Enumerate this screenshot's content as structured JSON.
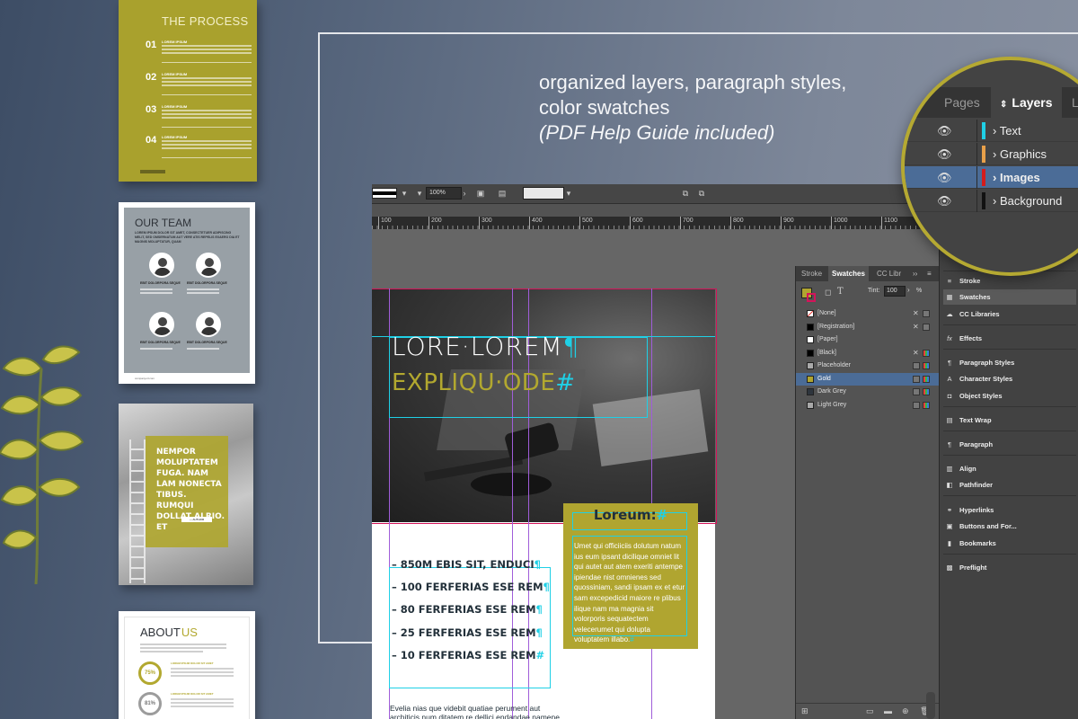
{
  "headline": {
    "line1": "organized layers, paragraph styles,",
    "line2": "color swatches",
    "line3": "(PDF Help Guide included)"
  },
  "thumbnails": {
    "process": {
      "title": "THE PROCESS",
      "steps": [
        {
          "num": "01",
          "title": "LOREM IPSUM"
        },
        {
          "num": "02",
          "title": "LOREM IPSUM"
        },
        {
          "num": "03",
          "title": "LOREM IPSUM"
        },
        {
          "num": "04",
          "title": "LOREM IPSUM"
        }
      ]
    },
    "team": {
      "title": "OUR TEAM",
      "intro": "LOREM IPSUM DOLOR SIT AMET, CONSECTETUER ADIPISCING MELIT, SED OMSERNATUM AUT VERE ATIS REPELIS EXAERO DIA ET MAGNIS MOLUPTATUR, QUAM",
      "members": [
        "EBIT DOLORPORA SEQUE",
        "EBIT DOLORPORA SEQUE",
        "EBIT DOLORPORA SEQUE",
        "EBIT DOLORPORA SEQUE"
      ],
      "footer": "companyurl.com"
    },
    "quote": {
      "text": "NEMPOR MOLUPTATEM FUGA. NAM LAM NONECTA TIBUS. RUMQUI DOLLAT ALRIO. ET",
      "button": "— AUTHOR"
    },
    "about": {
      "title_a": "ABOUT",
      "title_b": "US",
      "stat1": "75%",
      "stat2": "81%",
      "stat_label": "LOREM IPSUM DOLOR SIT AMET"
    }
  },
  "indesign": {
    "zoom": "100%",
    "ruler_ticks": [
      "100",
      "200",
      "300",
      "400",
      "500",
      "600",
      "700",
      "800",
      "900",
      "1000",
      "1100"
    ],
    "page": {
      "title1": "LORE·LOREM",
      "title1_mark": "¶",
      "title2": "EXPLIQU·ODE",
      "title2_mark": "#",
      "box_title": "Loreum:",
      "box_title_mark": "#",
      "box_body": "Umet qui officiiciis dolutum natum ius eum ipsant dicilique omniet lit qui autet aut atem exeriti antempe ipiendae nist omnienes sed quossiniam, sandi ipsam ex et etur sam excepedicid maiore re plibus ilique nam ma magnia sit volorporis sequatectem velecerumet qui dolupta voluptatem illabo.",
      "box_body_mark": "#",
      "list": [
        {
          "text": "– 850M EBIS SIT, ENDUCI",
          "mark": "¶"
        },
        {
          "text": "– 100 FERFERIAS ESE REM",
          "mark": "¶"
        },
        {
          "text": "– 80 FERFERIAS ESE REM",
          "mark": "¶"
        },
        {
          "text": "– 25 FERFERIAS ESE REM",
          "mark": "¶"
        },
        {
          "text": "– 10 FERFERIAS ESE REM",
          "mark": "#"
        }
      ],
      "paragraph": "Evelia nias que videbit quatiae perument aut architicis num ditatem re dellici endandae namene corecabore,"
    },
    "swatches_panel": {
      "tabs": [
        "Stroke",
        "Swatches",
        "CC Libr"
      ],
      "tint_label": "Tint:",
      "tint_value": "100",
      "tint_unit": "%",
      "items": [
        {
          "name": "[None]",
          "color": "#ffffff"
        },
        {
          "name": "[Registration]",
          "color": "#000000"
        },
        {
          "name": "[Paper]",
          "color": "#ffffff"
        },
        {
          "name": "[Black]",
          "color": "#000000"
        },
        {
          "name": "Placeholder",
          "color": "#aaaaaa"
        },
        {
          "name": "Gold",
          "color": "#b0a530",
          "selected": true
        },
        {
          "name": "Dark Grey",
          "color": "#2e353d"
        },
        {
          "name": "Light Grey",
          "color": "#a8a8a8"
        }
      ]
    },
    "dock": {
      "items": [
        {
          "icon": "stroke-icon",
          "glyph": "≡",
          "label": "Stroke"
        },
        {
          "icon": "swatches-icon",
          "glyph": "▦",
          "label": "Swatches",
          "highlight": true
        },
        {
          "icon": "cc-libraries-icon",
          "glyph": "☁",
          "label": "CC Libraries"
        },
        {
          "icon": "effects-icon",
          "glyph": "fx",
          "label": "Effects"
        },
        {
          "icon": "paragraph-styles-icon",
          "glyph": "¶",
          "label": "Paragraph Styles"
        },
        {
          "icon": "character-styles-icon",
          "glyph": "A",
          "label": "Character Styles"
        },
        {
          "icon": "object-styles-icon",
          "glyph": "◘",
          "label": "Object Styles"
        },
        {
          "icon": "text-wrap-icon",
          "glyph": "▤",
          "label": "Text Wrap"
        },
        {
          "icon": "paragraph-icon",
          "glyph": "¶",
          "label": "Paragraph"
        },
        {
          "icon": "align-icon",
          "glyph": "▥",
          "label": "Align"
        },
        {
          "icon": "pathfinder-icon",
          "glyph": "◧",
          "label": "Pathfinder"
        },
        {
          "icon": "hyperlinks-icon",
          "glyph": "⚭",
          "label": "Hyperlinks"
        },
        {
          "icon": "buttons-icon",
          "glyph": "▣",
          "label": "Buttons and For..."
        },
        {
          "icon": "bookmarks-icon",
          "glyph": "▮",
          "label": "Bookmarks"
        },
        {
          "icon": "preflight-icon",
          "glyph": "▩",
          "label": "Preflight"
        }
      ]
    }
  },
  "layers_panel": {
    "tabs": [
      "Pages",
      "Layers",
      "Li"
    ],
    "layers": [
      {
        "name": "Text",
        "color": "#1fd0e6"
      },
      {
        "name": "Graphics",
        "color": "#e8a04a"
      },
      {
        "name": "Images",
        "color": "#d41c1c",
        "selected": true
      },
      {
        "name": "Background",
        "color": "#111111"
      }
    ]
  }
}
